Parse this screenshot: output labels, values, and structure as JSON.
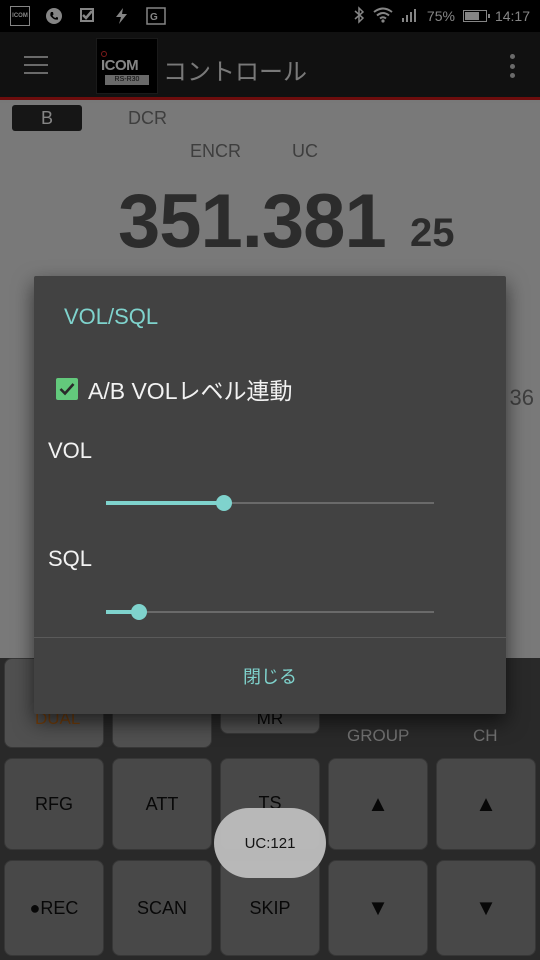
{
  "status_bar": {
    "icons": [
      "icom-app-icon",
      "phone-icon",
      "checkmark-icon",
      "flash-icon",
      "translate-icon"
    ],
    "icom_badge": "ICOM",
    "battery_percent": "75%",
    "battery_level": 0.75,
    "time": "14:17"
  },
  "app_bar": {
    "logo_brand": "ICOM",
    "logo_model": "RS-R30",
    "title": "コントロール"
  },
  "display": {
    "band": "B",
    "dcr": "DCR",
    "encr": "ENCR",
    "uc": "UC",
    "frequency_main": "351.381",
    "frequency_sub": "25",
    "side_value": "36"
  },
  "keypad": {
    "dual": "DUAL",
    "mr": "MR",
    "group": "GROUP",
    "ch": "CH",
    "rfg": "RFG",
    "att": "ATT",
    "ts": "TS",
    "up": "▲",
    "down": "▼",
    "rec": "●REC",
    "scan": "SCAN",
    "skip": "SKIP"
  },
  "toast": "UC:121",
  "dialog": {
    "title": "VOL/SQL",
    "link_checkbox_label": "A/B VOLレベル連動",
    "link_checked": true,
    "vol_label": "VOL",
    "vol_value": 0.36,
    "sql_label": "SQL",
    "sql_value": 0.1,
    "close_label": "閉じる"
  },
  "colors": {
    "accent": "#7fd3cd",
    "checkbox": "#63c97c",
    "app_bar_underline": "#d11a1a",
    "dual_text": "#e07a18"
  }
}
